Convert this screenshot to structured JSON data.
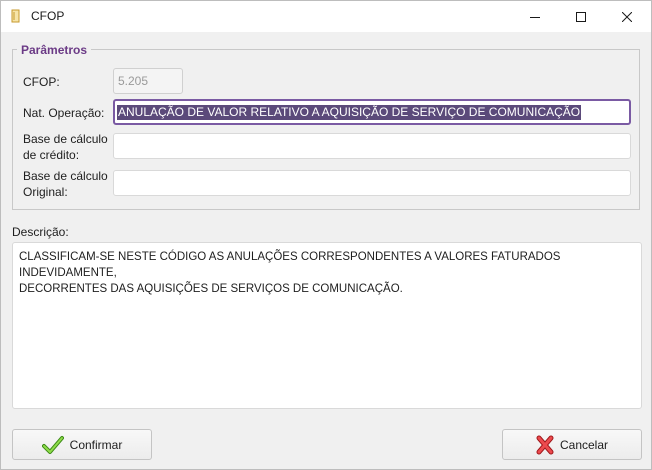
{
  "window": {
    "title": "CFOP",
    "minimize_icon": "minimize-icon",
    "maximize_icon": "maximize-icon",
    "close_icon": "close-icon"
  },
  "params": {
    "legend": "Parâmetros",
    "cfop_label": "CFOP:",
    "cfop_value": "5.205",
    "nat_label": "Nat. Operação:",
    "nat_value": "ANULAÇÃO DE VALOR RELATIVO A AQUISIÇÃO DE SERVIÇO DE COMUNICAÇÃO",
    "base_credito_label_1": "Base de cálculo",
    "base_credito_label_2": "de crédito:",
    "base_credito_value": "",
    "base_original_label_1": "Base de cálculo",
    "base_original_label_2": "Original:",
    "base_original_value": ""
  },
  "description": {
    "label": "Descrição:",
    "text_line_1": "CLASSIFICAM-SE NESTE CÓDIGO AS ANULAÇÕES CORRESPONDENTES A VALORES FATURADOS INDEVIDAMENTE,",
    "text_line_2": "DECORRENTES DAS AQUISIÇÕES DE SERVIÇOS DE COMUNICAÇÃO."
  },
  "buttons": {
    "confirm_label": "Confirmar",
    "confirm_icon": "checkmark-icon",
    "cancel_label": "Cancelar",
    "cancel_icon": "x-icon"
  },
  "colors": {
    "legend": "#6b3a86",
    "selection": "#5b4a7a",
    "focus_border": "#7a5aa3",
    "confirm_icon": "#6cbf2a",
    "cancel_icon": "#d9262b"
  }
}
